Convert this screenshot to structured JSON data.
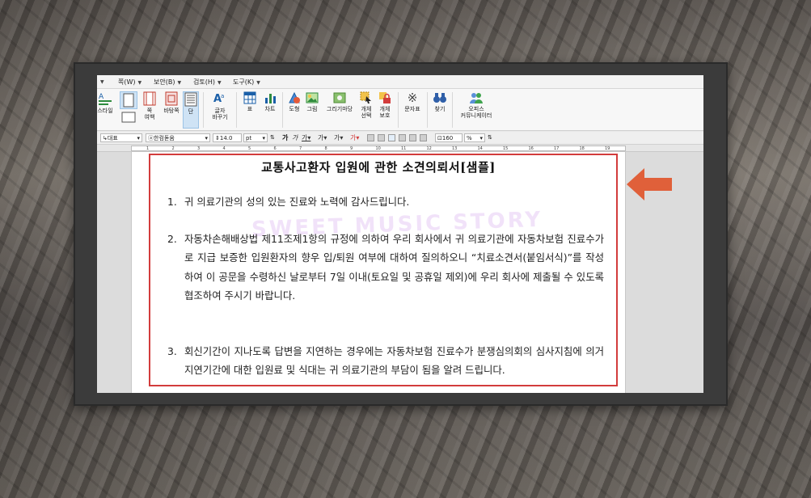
{
  "menu": [
    {
      "label": "쪽(W)"
    },
    {
      "label": "보안(B)"
    },
    {
      "label": "검토(H)"
    },
    {
      "label": "도구(K)"
    }
  ],
  "ribbon": {
    "style_label": "스타일",
    "page_margin_label": "쪽\n여백",
    "page_margin_line1": "쪽",
    "page_margin_line2": "여백",
    "background_label": "바탕쪽",
    "column_label": "단",
    "char_change_line1": "글자",
    "char_change_line2": "바꾸기",
    "table_label": "표",
    "chart_label": "차트",
    "shape_label": "도형",
    "picture_label": "그림",
    "drawing_label": "그리기마당",
    "object_select_line1": "개체",
    "object_select_line2": "선택",
    "object_protect_line1": "개체",
    "object_protect_line2": "보호",
    "symbol_label": "문자표",
    "find_label": "찾기",
    "office_line1": "오피스",
    "office_line2": "커뮤니케이터"
  },
  "format_bar": {
    "style_value": "대표",
    "font_value": "한컴돋움",
    "size_value": "14.0",
    "size_unit": "pt",
    "zoom_value": "160",
    "zoom_unit": "%"
  },
  "ruler": {
    "numbers": [
      "1",
      "2",
      "3",
      "4",
      "5",
      "6",
      "7",
      "8",
      "9",
      "10",
      "11",
      "12",
      "13",
      "14",
      "15",
      "16",
      "17",
      "18",
      "19"
    ]
  },
  "document": {
    "title": "교통사고환자 입원에 관한 소견의뢰서[샘플]",
    "watermark": "SWEET MUSIC STORY",
    "paragraphs": [
      {
        "num": "1.",
        "text": "귀 의료기관의 성의 있는 진료와 노력에 감사드립니다."
      },
      {
        "num": "2.",
        "text": "자동차손해배상법 제11조제1항의 규정에 의하여 우리 회사에서 귀 의료기관에 자동차보험 진료수가로 지급 보증한 입원환자의 향우 입/퇴원 여부에 대하여 질의하오니 “치료소견서(붙임서식)”를 작성하여 이 공문을 수령하신 날로부터 7일 이내(토요일 및 공휴일 제외)에 우리 회사에 제출될 수 있도록 협조하여 주시기 바랍니다."
      },
      {
        "num": "3.",
        "text": "회신기간이 지나도록 답변을 지연하는 경우에는 자동차보험 진료수가 분쟁심의회의 심사지침에 의거 지연기간에 대한 입원료 및 식대는 귀 의료기관의 부담이 됨을 알려 드립니다."
      }
    ]
  },
  "colors": {
    "highlight": "#d23c3c",
    "arrow": "#e0603a"
  }
}
